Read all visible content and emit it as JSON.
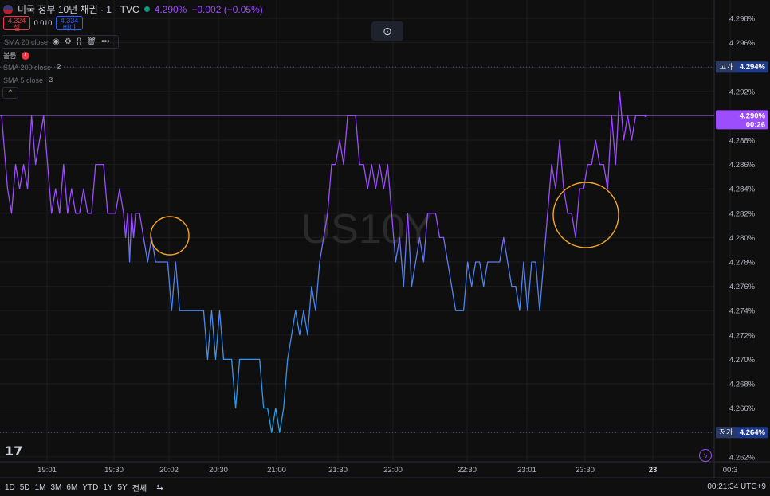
{
  "header": {
    "title": "미국 정부 10년 채권 · 1 · TVC",
    "price": "4.290%",
    "change": "−0.002 (−0.05%)"
  },
  "quote": {
    "sell_price": "4.324",
    "sell_label": "셀",
    "spread": "0.010",
    "buy_price": "4.334",
    "buy_label": "바이"
  },
  "indicators": {
    "sma20": "SMA 20 close",
    "volume": "볼륨",
    "sma200": "SMA 200 close",
    "sma5": "SMA 5 close"
  },
  "watermark": "US10Y",
  "badges": {
    "high_label": "고가",
    "high_value": "4.294%",
    "last_value": "4.290%",
    "countdown": "00:26",
    "low_label": "저가",
    "low_value": "4.264%"
  },
  "timeframes": [
    "1D",
    "5D",
    "1M",
    "3M",
    "6M",
    "YTD",
    "1Y",
    "5Y",
    "전체"
  ],
  "clock": "00:21:34 UTC+9",
  "colors": {
    "top": "#9c4dfc",
    "bottom": "#1fa2e8",
    "circle": "#f5a623",
    "badge_last": "#9c4dfc",
    "badge_hl": "#1e3a8a"
  },
  "chart_data": {
    "type": "line",
    "ylim": [
      4.262,
      4.299
    ],
    "y_ticks": [
      "4.298%",
      "4.296%",
      "4.294%",
      "4.292%",
      "4.290%",
      "4.288%",
      "4.286%",
      "4.284%",
      "4.282%",
      "4.280%",
      "4.278%",
      "4.276%",
      "4.274%",
      "4.272%",
      "4.270%",
      "4.268%",
      "4.266%",
      "4.264%",
      "4.262%"
    ],
    "x_ticks": [
      "19:01",
      "19:30",
      "20:02",
      "20:30",
      "21:00",
      "21:30",
      "22:00",
      "22:30",
      "23:01",
      "23:30",
      "23",
      "00:3"
    ],
    "x": [
      "18:50",
      "18:51",
      "18:52",
      "18:53",
      "18:55",
      "18:56",
      "18:57",
      "18:58",
      "18:59",
      "19:00",
      "19:02",
      "19:04",
      "19:06",
      "19:08",
      "19:10",
      "19:12",
      "19:14",
      "19:16",
      "19:18",
      "19:20",
      "19:22",
      "19:24",
      "19:26",
      "19:28",
      "19:30",
      "19:32",
      "19:34",
      "19:36",
      "19:38",
      "19:40",
      "19:42",
      "19:44",
      "19:46",
      "19:48",
      "19:50",
      "19:52",
      "19:54",
      "19:56",
      "19:58",
      "20:00",
      "20:01",
      "20:02",
      "20:03",
      "20:04",
      "20:05",
      "20:06",
      "20:08",
      "20:10",
      "20:12",
      "20:14",
      "20:16",
      "20:18",
      "20:20",
      "20:22",
      "20:24",
      "20:26",
      "20:28",
      "20:30",
      "20:32",
      "20:34",
      "20:36",
      "20:38",
      "20:40",
      "20:42",
      "20:44",
      "20:46",
      "20:48",
      "20:50",
      "20:52",
      "20:54",
      "20:56",
      "20:58",
      "21:00",
      "21:02",
      "21:04",
      "21:06",
      "21:08",
      "21:10",
      "21:12",
      "21:14",
      "21:16",
      "21:18",
      "21:20",
      "21:22",
      "21:24",
      "21:26",
      "21:28",
      "21:30",
      "21:32",
      "21:34",
      "21:36",
      "21:38",
      "21:40",
      "21:42",
      "21:44",
      "21:46",
      "21:48",
      "21:50",
      "21:52",
      "21:54",
      "21:56",
      "21:58",
      "22:00",
      "22:02",
      "22:04",
      "22:06",
      "22:08",
      "22:10",
      "22:12",
      "22:14",
      "22:16",
      "22:18",
      "22:20",
      "22:22",
      "22:24",
      "22:26",
      "22:28",
      "22:30",
      "22:32",
      "22:34",
      "22:36",
      "22:38",
      "22:40",
      "22:42",
      "22:44",
      "22:46",
      "22:48",
      "22:50",
      "22:52",
      "22:54",
      "22:56",
      "22:58",
      "23:00",
      "23:02",
      "23:04",
      "23:06",
      "23:08",
      "23:10",
      "23:12",
      "23:14",
      "23:16",
      "23:18",
      "23:20",
      "23:22",
      "23:24",
      "23:26",
      "23:28",
      "23:30",
      "23:32",
      "23:34",
      "23:36",
      "23:38",
      "23:40",
      "23:42",
      "23:44",
      "23:46",
      "23:48",
      "23:50",
      "23:52",
      "23:54",
      "23:56",
      "23:58",
      "00:00",
      "00:02",
      "00:04",
      "00:06",
      "00:08",
      "00:10",
      "00:12",
      "00:14",
      "00:16",
      "00:18",
      "00:20",
      "00:21"
    ],
    "values": [
      4.286,
      4.286,
      4.286,
      4.288,
      4.286,
      4.288,
      4.288,
      4.29,
      4.29,
      4.288,
      4.284,
      4.282,
      4.286,
      4.284,
      4.286,
      4.284,
      4.29,
      4.286,
      4.288,
      4.29,
      4.286,
      4.282,
      4.284,
      4.282,
      4.286,
      4.282,
      4.284,
      4.282,
      4.282,
      4.284,
      4.282,
      4.282,
      4.286,
      4.286,
      4.286,
      4.282,
      4.282,
      4.282,
      4.284,
      4.282,
      4.28,
      4.282,
      4.278,
      4.282,
      4.28,
      4.282,
      4.282,
      4.28,
      4.278,
      4.28,
      4.278,
      4.278,
      4.278,
      4.278,
      4.274,
      4.278,
      4.274,
      4.274,
      4.274,
      4.274,
      4.274,
      4.274,
      4.274,
      4.27,
      4.274,
      4.27,
      4.274,
      4.27,
      4.27,
      4.27,
      4.266,
      4.27,
      4.27,
      4.27,
      4.27,
      4.27,
      4.27,
      4.266,
      4.266,
      4.264,
      4.266,
      4.264,
      4.266,
      4.27,
      4.272,
      4.274,
      4.272,
      4.274,
      4.272,
      4.276,
      4.274,
      4.278,
      4.28,
      4.282,
      4.286,
      4.286,
      4.288,
      4.286,
      4.29,
      4.29,
      4.29,
      4.286,
      4.286,
      4.284,
      4.286,
      4.284,
      4.286,
      4.284,
      4.286,
      4.282,
      4.278,
      4.28,
      4.276,
      4.282,
      4.276,
      4.278,
      4.28,
      4.278,
      4.282,
      4.282,
      4.282,
      4.28,
      4.28,
      4.278,
      4.276,
      4.274,
      4.274,
      4.274,
      4.278,
      4.276,
      4.278,
      4.278,
      4.276,
      4.278,
      4.278,
      4.278,
      4.278,
      4.28,
      4.278,
      4.276,
      4.276,
      4.274,
      4.278,
      4.274,
      4.278,
      4.278,
      4.274,
      4.278,
      4.282,
      4.286,
      4.284,
      4.288,
      4.284,
      4.282,
      4.282,
      4.28,
      4.284,
      4.284,
      4.286,
      4.286,
      4.288,
      4.286,
      4.286,
      4.284,
      4.29,
      4.286,
      4.292,
      4.288,
      4.29,
      4.288,
      4.29,
      4.29,
      4.29,
      4.29,
      4.29,
      4.29,
      4.29,
      4.292,
      4.29
    ],
    "split_at": 4.281,
    "annotations": [
      {
        "shape": "circle",
        "cx_time": "20:02",
        "cy_value": 4.2805
      },
      {
        "shape": "circle",
        "cx_time": "23:30",
        "cy_value": 4.2822
      }
    ],
    "reference_lines": [
      {
        "value": 4.294,
        "style": "dotted"
      },
      {
        "value": 4.29,
        "style": "solid"
      },
      {
        "value": 4.264,
        "style": "dotted"
      }
    ],
    "grid": true
  }
}
